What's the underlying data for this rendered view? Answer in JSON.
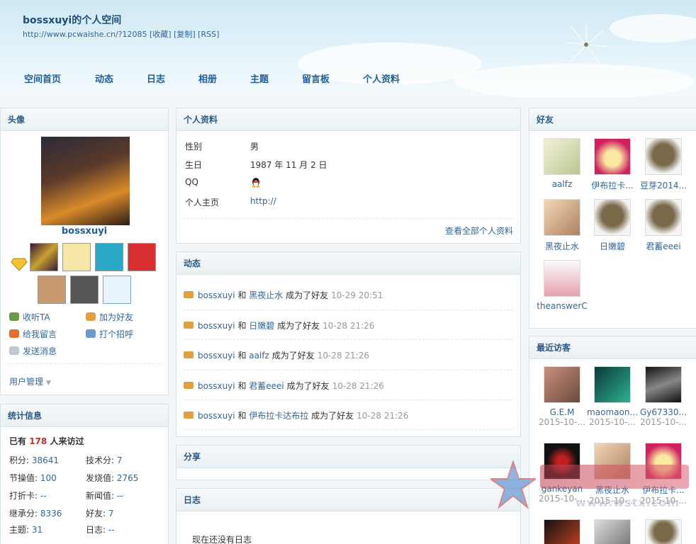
{
  "header": {
    "title": "bossxuyi的个人空间",
    "url_line": "http://www.pcwaishe.cn/?12085 [收藏] [复制] [RSS]"
  },
  "nav": [
    "空间首页",
    "动态",
    "日志",
    "相册",
    "主题",
    "留言板",
    "个人资料"
  ],
  "avatar_panel": {
    "title": "头像",
    "username": "bossxuyi",
    "actions": {
      "follow": "收听TA",
      "add_friend": "加为好友",
      "leave_message": "给我留言",
      "greet": "打个招呼",
      "send_message": "发送消息"
    },
    "user_manage": "用户管理"
  },
  "stats": {
    "title": "统计信息",
    "visit_prefix": "已有",
    "visit_count": "178",
    "visit_suffix": "人来访过",
    "items": [
      {
        "label": "积分:",
        "value": "38641"
      },
      {
        "label": "技术分:",
        "value": "7"
      },
      {
        "label": "节操值:",
        "value": "100"
      },
      {
        "label": "发烧值:",
        "value": "2765"
      },
      {
        "label": "打折卡:",
        "value": "--"
      },
      {
        "label": "新闻值:",
        "value": "--"
      },
      {
        "label": "继承分:",
        "value": "8336"
      },
      {
        "label": "好友:",
        "value": "7"
      },
      {
        "label": "主题:",
        "value": "31"
      },
      {
        "label": "日志:",
        "value": "--"
      }
    ]
  },
  "profile": {
    "title": "个人资料",
    "fields": [
      {
        "label": "性别",
        "value": "男"
      },
      {
        "label": "生日",
        "value": "1987 年 11 月 2 日"
      },
      {
        "label": "QQ",
        "value": ""
      },
      {
        "label": "个人主页",
        "value": "http://"
      }
    ],
    "view_all": "查看全部个人资料"
  },
  "feed": {
    "title": "动态",
    "items": [
      {
        "user": "bossxuyi",
        "and": "和",
        "friend": "黑夜止水",
        "text": "成为了好友",
        "time": "10-29 20:51"
      },
      {
        "user": "bossxuyi",
        "and": "和",
        "friend": "日嫩碧",
        "text": "成为了好友",
        "time": "10-28 21:26"
      },
      {
        "user": "bossxuyi",
        "and": "和",
        "friend": "aalfz",
        "text": "成为了好友",
        "time": "10-28 21:26"
      },
      {
        "user": "bossxuyi",
        "and": "和",
        "friend": "君蓄eeei",
        "text": "成为了好友",
        "time": "10-28 21:26"
      },
      {
        "user": "bossxuyi",
        "and": "和",
        "friend": "伊布拉卡达布拉",
        "text": "成为了好友",
        "time": "10-28 21:26"
      }
    ]
  },
  "share": {
    "title": "分享"
  },
  "blog": {
    "title": "日志",
    "empty": "现在还没有日志"
  },
  "friends": {
    "title": "好友",
    "items": [
      "aalfz",
      "伊布拉卡...",
      "豆芽2014...",
      "黑夜止水",
      "日嫩碧",
      "君蓄eeei",
      "theanswerC"
    ]
  },
  "visitors": {
    "title": "最近访客",
    "items": [
      {
        "name": "G.E.M",
        "date": "2015-10-..."
      },
      {
        "name": "maomaon...",
        "date": "2015-10-..."
      },
      {
        "name": "Gy67330...",
        "date": "2015-10-..."
      },
      {
        "name": "gankeyan",
        "date": "2015-10-..."
      },
      {
        "name": "黑夜止水",
        "date": "2015-10-..."
      },
      {
        "name": "伊布拉卡...",
        "date": "2015-10-..."
      }
    ]
  },
  "watermark": "www.wstx.com"
}
